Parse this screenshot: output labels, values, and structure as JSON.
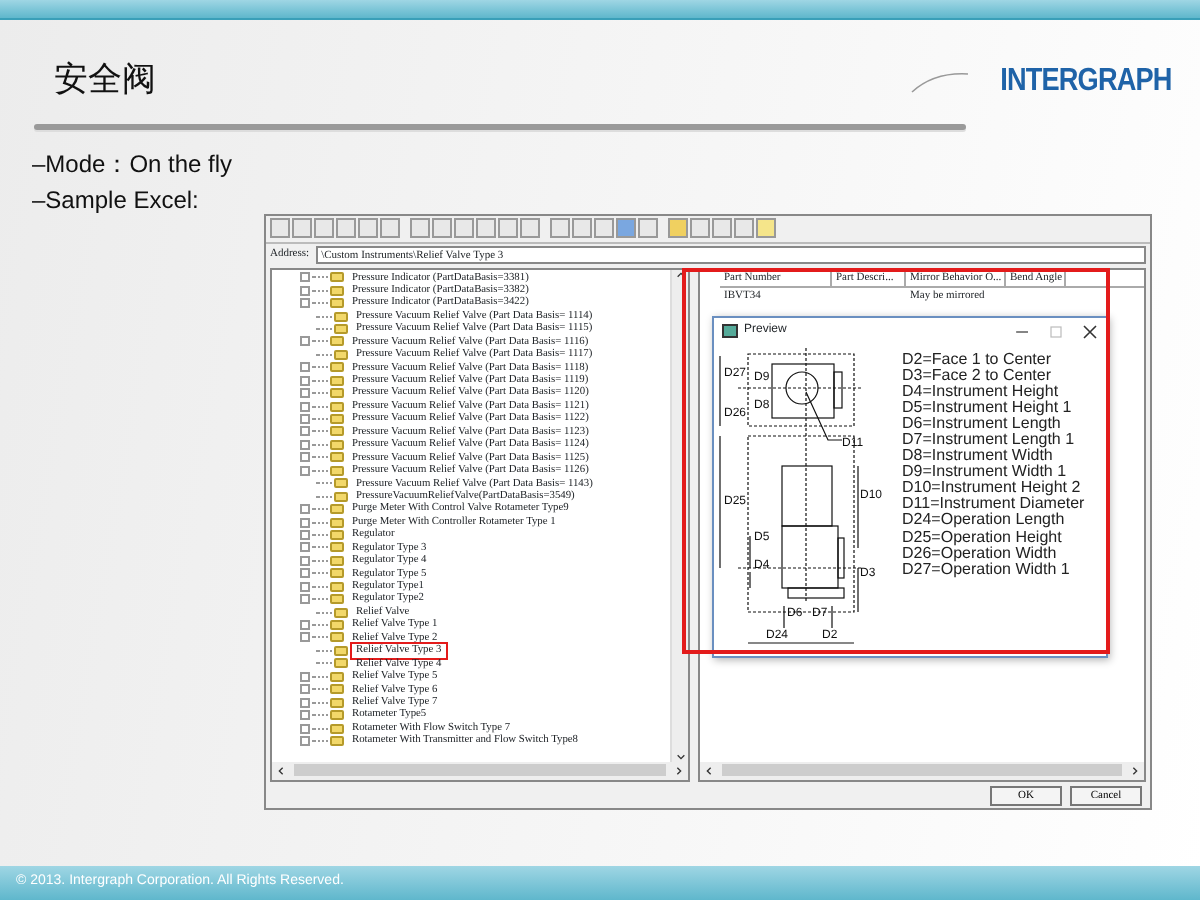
{
  "slide": {
    "title": "安全阀",
    "logo": "INTERGRAPH",
    "bullets": [
      "–Mode：On the fly",
      "–Sample Excel:"
    ],
    "footer": "© 2013. Intergraph Corporation. All Rights Reserved."
  },
  "app": {
    "address_label": "Address:",
    "address": "\\Custom Instruments\\Relief Valve Type 3",
    "tree": [
      {
        "label": "Pressure Indicator (PartDataBasis=3381)",
        "expandable": true,
        "selected": false
      },
      {
        "label": "Pressure Indicator (PartDataBasis=3382)",
        "expandable": true,
        "selected": false
      },
      {
        "label": "Pressure Indicator (PartDataBasis=3422)",
        "expandable": true,
        "selected": false
      },
      {
        "label": "Pressure Vacuum Relief Valve (Part Data Basis= 1114)",
        "expandable": false,
        "selected": false
      },
      {
        "label": "Pressure Vacuum Relief Valve (Part Data Basis= 1115)",
        "expandable": false,
        "selected": false
      },
      {
        "label": "Pressure Vacuum Relief Valve (Part Data Basis= 1116)",
        "expandable": true,
        "selected": false
      },
      {
        "label": "Pressure Vacuum Relief Valve (Part Data Basis= 1117)",
        "expandable": false,
        "selected": false
      },
      {
        "label": "Pressure Vacuum Relief Valve (Part Data Basis= 1118)",
        "expandable": true,
        "selected": false
      },
      {
        "label": "Pressure Vacuum Relief Valve (Part Data Basis= 1119)",
        "expandable": true,
        "selected": false
      },
      {
        "label": "Pressure Vacuum Relief Valve (Part Data Basis= 1120)",
        "expandable": true,
        "selected": false
      },
      {
        "label": "Pressure Vacuum Relief Valve (Part Data Basis= 1121)",
        "expandable": true,
        "selected": false
      },
      {
        "label": "Pressure Vacuum Relief Valve (Part Data Basis= 1122)",
        "expandable": true,
        "selected": false
      },
      {
        "label": "Pressure Vacuum Relief Valve (Part Data Basis= 1123)",
        "expandable": true,
        "selected": false
      },
      {
        "label": "Pressure Vacuum Relief Valve (Part Data Basis= 1124)",
        "expandable": true,
        "selected": false
      },
      {
        "label": "Pressure Vacuum Relief Valve (Part Data Basis= 1125)",
        "expandable": true,
        "selected": false
      },
      {
        "label": "Pressure Vacuum Relief Valve (Part Data Basis= 1126)",
        "expandable": true,
        "selected": false
      },
      {
        "label": "Pressure Vacuum Relief Valve (Part Data Basis= 1143)",
        "expandable": false,
        "selected": false
      },
      {
        "label": "PressureVacuumReliefValve(PartDataBasis=3549)",
        "expandable": false,
        "selected": false
      },
      {
        "label": "Purge Meter With Control Valve Rotameter Type9",
        "expandable": true,
        "selected": false
      },
      {
        "label": "Purge Meter With Controller Rotameter Type 1",
        "expandable": true,
        "selected": false
      },
      {
        "label": "Regulator",
        "expandable": true,
        "selected": false
      },
      {
        "label": "Regulator Type 3",
        "expandable": true,
        "selected": false
      },
      {
        "label": "Regulator Type 4",
        "expandable": true,
        "selected": false
      },
      {
        "label": "Regulator Type 5",
        "expandable": true,
        "selected": false
      },
      {
        "label": "Regulator Type1",
        "expandable": true,
        "selected": false
      },
      {
        "label": "Regulator Type2",
        "expandable": true,
        "selected": false
      },
      {
        "label": "Relief Valve",
        "expandable": false,
        "selected": false
      },
      {
        "label": "Relief Valve Type 1",
        "expandable": true,
        "selected": false
      },
      {
        "label": "Relief Valve Type 2",
        "expandable": true,
        "selected": false
      },
      {
        "label": "Relief Valve Type 3",
        "expandable": false,
        "selected": true
      },
      {
        "label": "Relief Valve Type 4",
        "expandable": false,
        "selected": false
      },
      {
        "label": "Relief Valve Type 5",
        "expandable": true,
        "selected": false
      },
      {
        "label": "Relief Valve Type 6",
        "expandable": true,
        "selected": false
      },
      {
        "label": "Relief Valve Type 7",
        "expandable": true,
        "selected": false
      },
      {
        "label": "Rotameter Type5",
        "expandable": true,
        "selected": false
      },
      {
        "label": "Rotameter With Flow Switch Type 7",
        "expandable": true,
        "selected": false
      },
      {
        "label": "Rotameter With Transmitter and  Flow Switch Type8",
        "expandable": true,
        "selected": false
      }
    ],
    "table": {
      "columns": [
        "Part Number",
        "Part Descri...",
        "Mirror Behavior O...",
        "Bend Angle"
      ],
      "rows": [
        [
          "IBVT34",
          "",
          "May be mirrored",
          ""
        ]
      ]
    },
    "buttons": [
      "OK",
      "Cancel"
    ],
    "preview": {
      "title": "Preview",
      "dimension_labels": [
        "D27",
        "D9",
        "D8",
        "D26",
        "D11",
        "D25",
        "D10",
        "D5",
        "D4",
        "D3",
        "D6",
        "D7",
        "D24",
        "D2"
      ],
      "legend": [
        "D2=Face 1 to Center",
        "D3=Face 2 to Center",
        "D4=Instrument Height",
        "D5=Instrument Height 1",
        "D6=Instrument Length",
        "D7=Instrument Length 1",
        "D8=Instrument Width",
        "D9=Instrument Width 1",
        "D10=Instrument Height 2",
        "D11=Instrument Diameter",
        "D24=Operation Length",
        "D25=Operation Height",
        "D26=Operation Width",
        "D27=Operation Width 1"
      ]
    }
  }
}
